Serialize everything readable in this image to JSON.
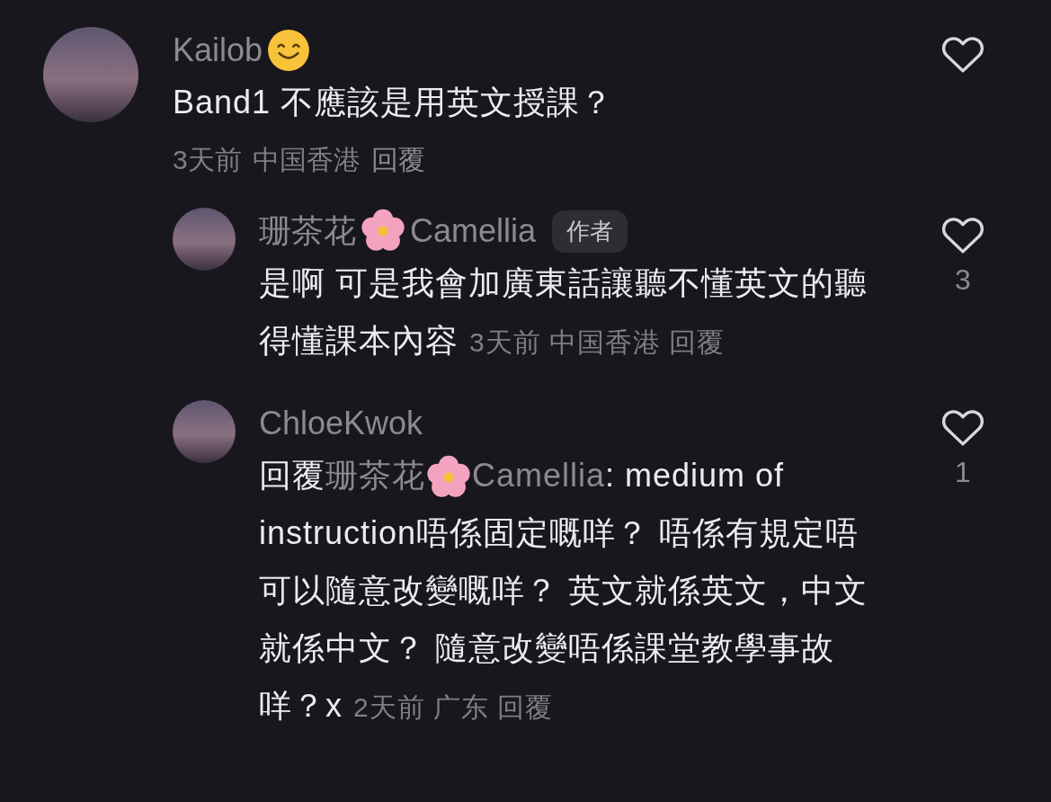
{
  "comments": [
    {
      "name_segments": [
        {
          "kind": "text",
          "text": "Kailob"
        },
        {
          "kind": "smiley"
        }
      ],
      "body_segments": [
        {
          "kind": "text",
          "text": "Band1 不應該是用英文授課？"
        }
      ],
      "time": "3天前",
      "location": "中国香港",
      "reply": "回覆",
      "replies": [
        {
          "name_segments": [
            {
              "kind": "text",
              "text": "珊茶花"
            },
            {
              "kind": "flower"
            },
            {
              "kind": "text",
              "text": "Camellia"
            }
          ],
          "badge": "作者",
          "body_segments": [
            {
              "kind": "text",
              "text": "是啊 可是我會加廣東話讓聽不懂英文的聽得懂課本內容"
            }
          ],
          "time": "3天前",
          "location": "中国香港",
          "reply": "回覆",
          "likes": "3"
        },
        {
          "name_segments": [
            {
              "kind": "text",
              "text": "ChloeKwok"
            }
          ],
          "body_segments": [
            {
              "kind": "text",
              "text": "回覆"
            },
            {
              "kind": "mention",
              "text": "珊茶花"
            },
            {
              "kind": "flower"
            },
            {
              "kind": "mention",
              "text": "Camellia"
            },
            {
              "kind": "text",
              "text": ": medium of instruction唔係固定嘅咩？ 唔係有規定唔可以隨意改變嘅咩？ 英文就係英文，中文就係中文？ 隨意改變唔係課堂教學事故咩？x"
            }
          ],
          "time": "2天前",
          "location": "广东",
          "reply": "回覆",
          "likes": "1"
        }
      ]
    }
  ]
}
